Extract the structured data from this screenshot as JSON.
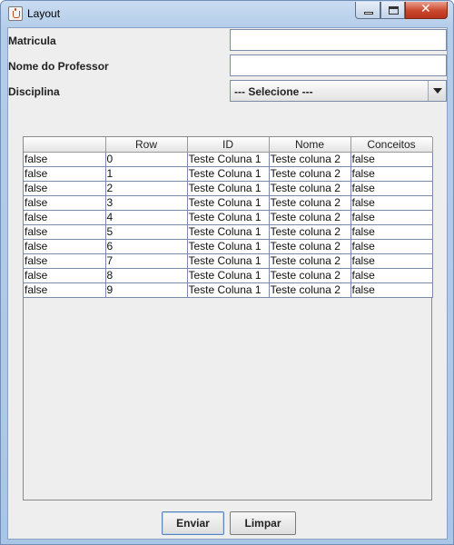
{
  "window": {
    "title": "Layout",
    "close_glyph": "✕"
  },
  "form": {
    "matricula_label": "Matricula",
    "matricula_value": "",
    "professor_label": "Nome do Professor",
    "professor_value": "",
    "disciplina_label": "Disciplina",
    "disciplina_selected": "--- Selecione ---"
  },
  "table": {
    "columns": [
      "",
      "Row",
      "ID",
      "Nome",
      "Conceitos"
    ],
    "rows": [
      [
        "false",
        "0",
        "Teste Coluna 1",
        "Teste coluna 2",
        "false"
      ],
      [
        "false",
        "1",
        "Teste Coluna 1",
        "Teste coluna 2",
        "false"
      ],
      [
        "false",
        "2",
        "Teste Coluna 1",
        "Teste coluna 2",
        "false"
      ],
      [
        "false",
        "3",
        "Teste Coluna 1",
        "Teste coluna 2",
        "false"
      ],
      [
        "false",
        "4",
        "Teste Coluna 1",
        "Teste coluna 2",
        "false"
      ],
      [
        "false",
        "5",
        "Teste Coluna 1",
        "Teste coluna 2",
        "false"
      ],
      [
        "false",
        "6",
        "Teste Coluna 1",
        "Teste coluna 2",
        "false"
      ],
      [
        "false",
        "7",
        "Teste Coluna 1",
        "Teste coluna 2",
        "false"
      ],
      [
        "false",
        "8",
        "Teste Coluna 1",
        "Teste coluna 2",
        "false"
      ],
      [
        "false",
        "9",
        "Teste Coluna 1",
        "Teste coluna 2",
        "false"
      ]
    ]
  },
  "buttons": {
    "send_label": "Enviar",
    "clear_label": "Limpar"
  }
}
